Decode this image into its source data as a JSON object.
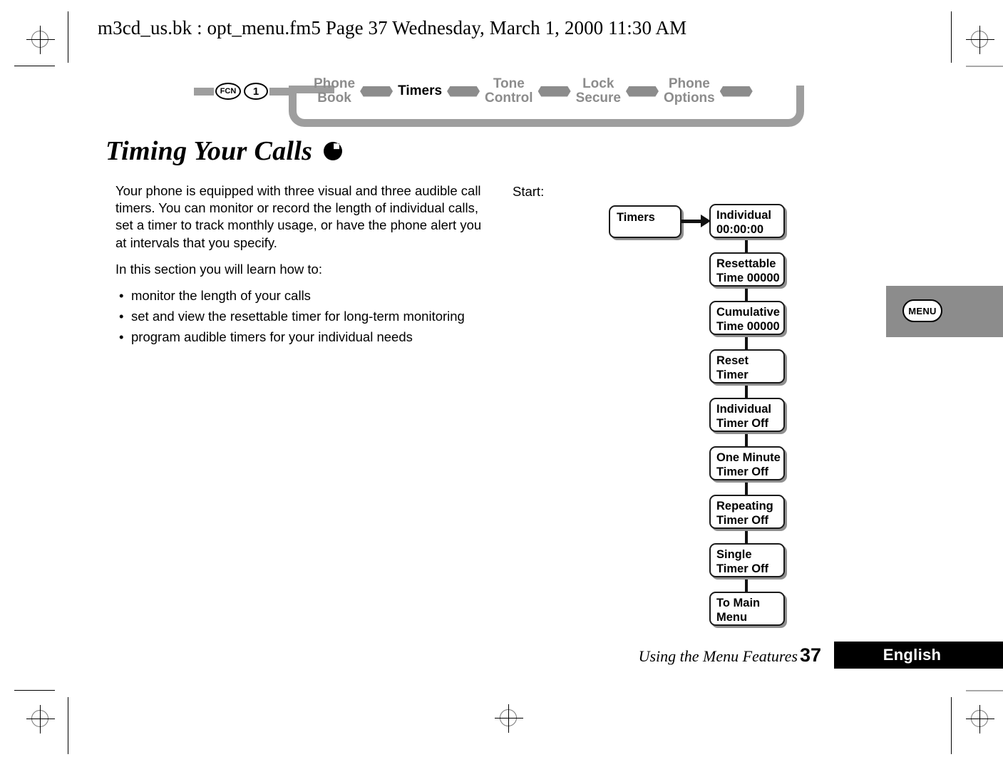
{
  "document_header": "m3cd_us.bk : opt_menu.fm5  Page 37  Wednesday, March 1, 2000  11:30 AM",
  "nav": {
    "keys": [
      {
        "label": "FCN",
        "name": "fcn-key"
      },
      {
        "label": "1",
        "name": "one-key"
      }
    ],
    "items": [
      {
        "label": "Phone\nBook",
        "active": false
      },
      {
        "label": "Timers",
        "active": true
      },
      {
        "label": "Tone\nControl",
        "active": false
      },
      {
        "label": "Lock\nSecure",
        "active": false
      },
      {
        "label": "Phone\nOptions",
        "active": false
      }
    ]
  },
  "page_title": "Timing Your Calls",
  "body": {
    "intro": "Your phone is equipped with three visual and three audible call timers. You can monitor or record the length of individual calls, set a timer to track monthly usage, or have the phone alert you at intervals that you specify.",
    "list_lead": "In this section you will learn how to:",
    "bullet_glyph": "•",
    "bullets": [
      "monitor the length of your calls",
      "set and view the resettable timer for long-term monitoring",
      "program audible timers for your individual needs"
    ]
  },
  "flow": {
    "start_label": "Start:",
    "start_node": "Timers",
    "nodes": [
      "Individual\n00:00:00",
      "Resettable\nTime 00000",
      "Cumulative\nTime 00000",
      "Reset\nTimer",
      "Individual\nTimer Off",
      "One Minute\nTimer Off",
      "Repeating\nTimer Off",
      "Single\nTimer Off",
      "To Main\nMenu"
    ]
  },
  "menu_tab": {
    "key_label": "MENU"
  },
  "footer": {
    "chapter": "Using the Menu Features",
    "page_number": "37",
    "language": "English"
  },
  "colors": {
    "nav_inactive": "#8c8c8c",
    "nav_active": "#000000",
    "tab_background": "#8c8c8c",
    "footer_bar": "#000000",
    "box_shadow": "#8f8f8f"
  }
}
